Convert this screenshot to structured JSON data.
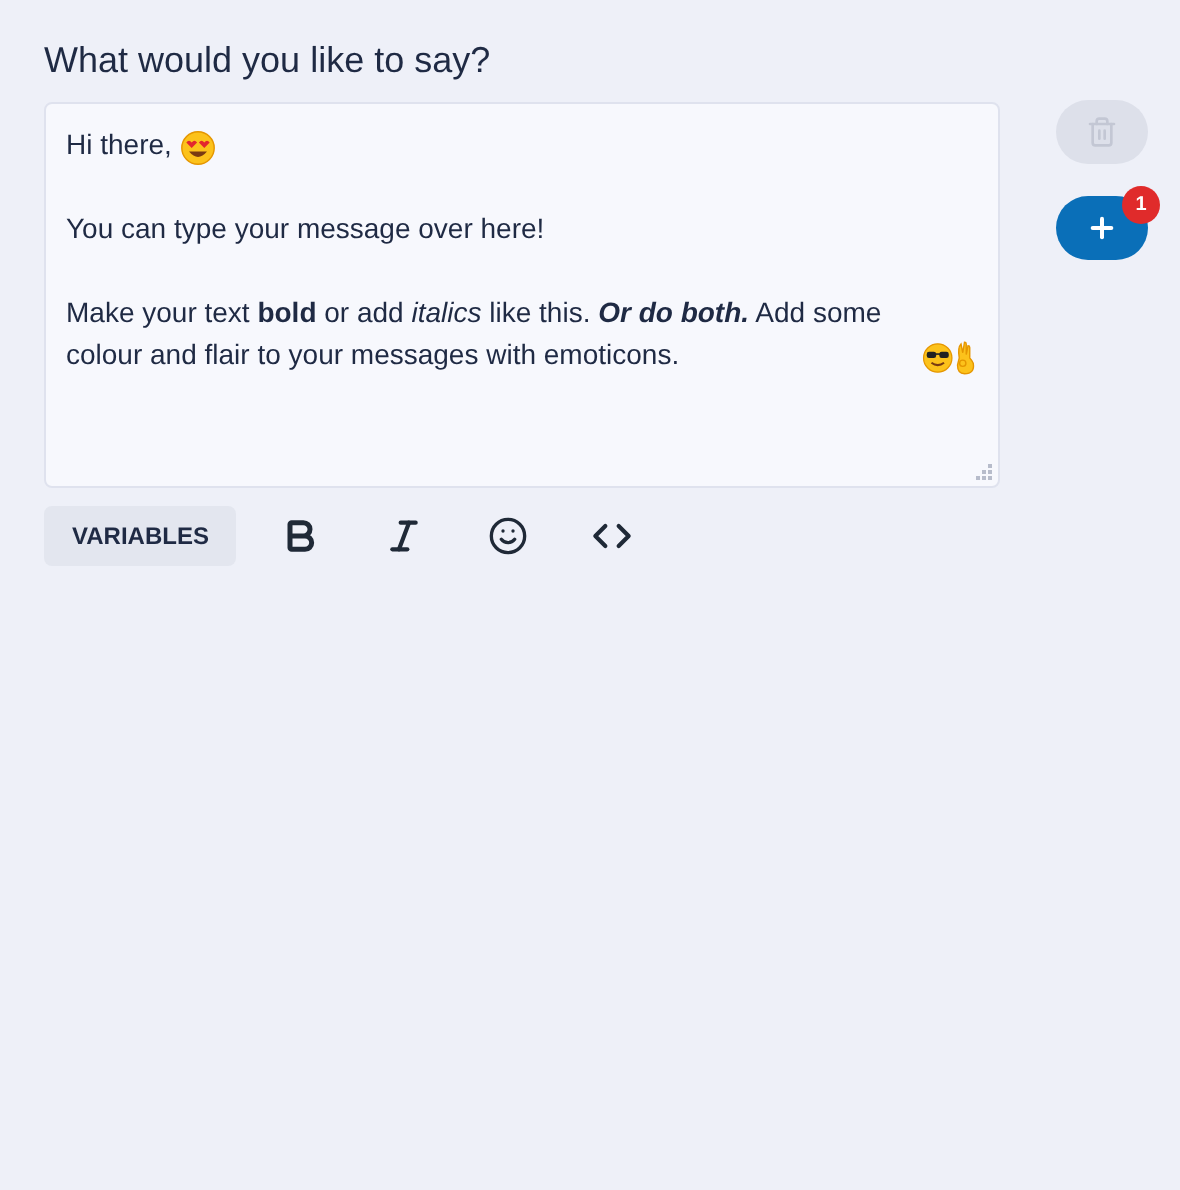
{
  "heading": "What would you like to say?",
  "message": {
    "paragraphs": [
      {
        "segments": [
          {
            "text": "Hi there,",
            "bold": false,
            "italic": false
          }
        ],
        "emoticons": [
          {
            "kind": "heart-eyes"
          }
        ]
      },
      {
        "segments": [
          {
            "text": "You can type your message over here!",
            "bold": false,
            "italic": false
          }
        ]
      },
      {
        "segments": [
          {
            "text": "Make your text ",
            "bold": false,
            "italic": false
          },
          {
            "text": "bold",
            "bold": true,
            "italic": false
          },
          {
            "text": " or add ",
            "bold": false,
            "italic": false
          },
          {
            "text": "italics",
            "bold": false,
            "italic": true
          },
          {
            "text": " like this. ",
            "bold": false,
            "italic": false
          },
          {
            "text": "Or do both.",
            "bold": true,
            "italic": true
          },
          {
            "text": " Add some colour and flair to your messages with emoticons.",
            "bold": false,
            "italic": false
          }
        ],
        "emoticons": [
          {
            "kind": "sunglasses"
          },
          {
            "kind": "ok-hand"
          }
        ]
      }
    ]
  },
  "toolbar": {
    "variables_button": "VARIABLES",
    "tools": [
      {
        "kind": "bold"
      },
      {
        "kind": "italic"
      },
      {
        "kind": "emoji"
      },
      {
        "kind": "code"
      }
    ]
  },
  "delete_button": {
    "disabled": true
  },
  "add_button": {
    "badge": "1"
  }
}
